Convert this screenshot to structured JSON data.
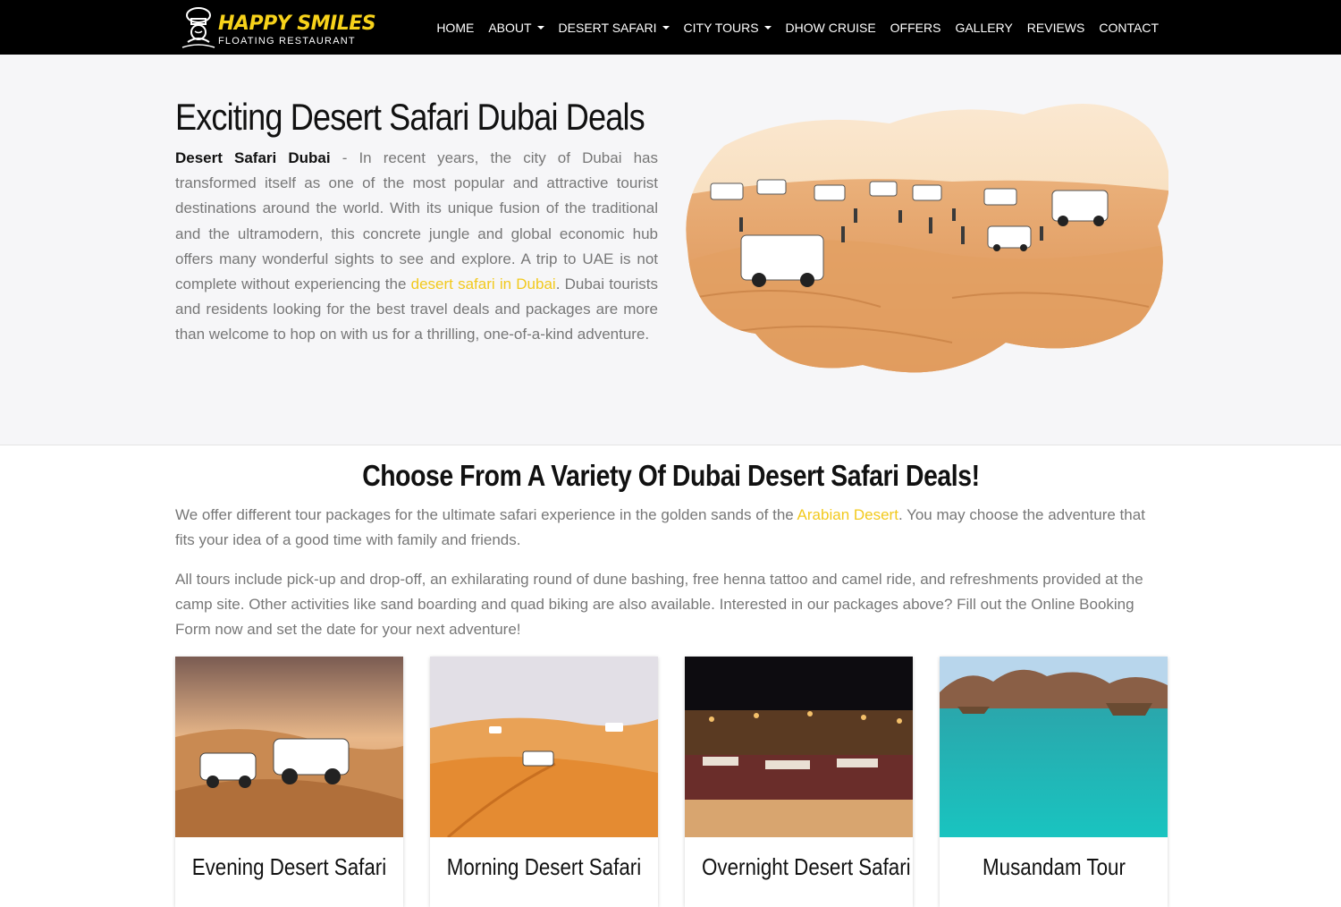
{
  "brand": {
    "title": "HAPPY SMILES",
    "subtitle": "FLOATING RESTAURANT"
  },
  "nav": [
    {
      "label": "HOME",
      "dropdown": false
    },
    {
      "label": "ABOUT",
      "dropdown": true
    },
    {
      "label": "DESERT SAFARI",
      "dropdown": true
    },
    {
      "label": "CITY TOURS",
      "dropdown": true
    },
    {
      "label": "DHOW CRUISE",
      "dropdown": false
    },
    {
      "label": "OFFERS",
      "dropdown": false
    },
    {
      "label": "GALLERY",
      "dropdown": false
    },
    {
      "label": "REVIEWS",
      "dropdown": false
    },
    {
      "label": "CONTACT",
      "dropdown": false
    }
  ],
  "hero": {
    "title": "Exciting Desert Safari Dubai Deals",
    "lead": "Desert Safari Dubai",
    "text_before_link": " - In recent years, the city of Dubai has transformed itself as one of the most popular and attractive tourist destinations around the world. With its unique fusion of the traditional and the ultramodern, this concrete jungle and global economic hub offers many wonderful sights to see and explore. A trip to UAE is not complete without experiencing the ",
    "link": "desert safari in Dubai",
    "text_after_link": ". Dubai tourists and residents looking for the best travel deals and packages are more than welcome to hop on with us for a thrilling, one-of-a-kind adventure."
  },
  "deals": {
    "title": "Choose From A Variety Of Dubai Desert Safari Deals!",
    "p1_before": "We offer different tour packages for the ultimate safari experience in the golden sands of the ",
    "p1_link": "Arabian Desert",
    "p1_after": ". You may choose the adventure that fits your idea of a good time with family and friends.",
    "p2": "All tours include pick-up and drop-off, an exhilarating round of dune bashing, free henna tattoo and camel ride, and refreshments provided at the camp site. Other activities like sand boarding and quad biking are also available. Interested in our packages above? Fill out the Online Booking Form now and set the date for your next adventure!"
  },
  "cards": [
    {
      "title": "Evening Desert Safari"
    },
    {
      "title": "Morning Desert Safari"
    },
    {
      "title": "Overnight Desert Safari"
    },
    {
      "title": "Musandam Tour"
    }
  ],
  "colors": {
    "accent": "#f2c91d",
    "navbar": "#000000",
    "hero_bg": "#f6f6f8"
  }
}
